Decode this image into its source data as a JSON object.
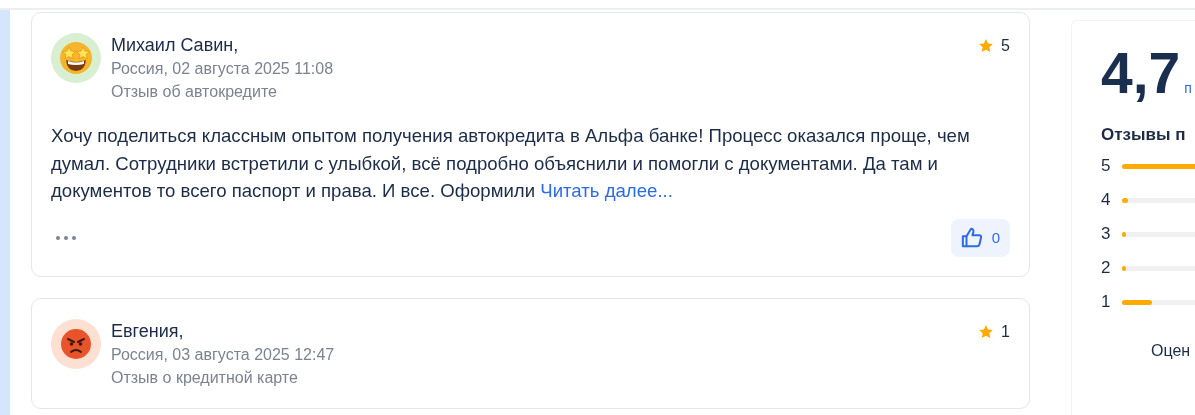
{
  "reviews": [
    {
      "author": "Михаил Савин,",
      "meta": "Россия, 02 августа 2025 11:08",
      "category": "Отзыв об автокредите",
      "kind": "star-struck",
      "rating": "5",
      "text": "Хочу поделиться классным опытом получения автокредита в Альфа банке! Процесс оказался проще, чем думал. Сотрудники встретили с улыбкой, всё подробно объяснили и помогли с документами. Да там и документов то всего паспорт и права. И все. Оформили",
      "read_more": "Читать далее...",
      "likes": "0"
    },
    {
      "author": "Евгения,",
      "meta": "Россия, 03 августа 2025 12:47",
      "category": "Отзыв о кредитной карте",
      "kind": "angry",
      "rating": "1"
    }
  ],
  "summary": {
    "score": "4,7",
    "score_link": "п",
    "title": "Отзывы п",
    "distribution": [
      {
        "label": "5",
        "level": 0.8
      },
      {
        "label": "4",
        "level": 0.04
      },
      {
        "label": "3",
        "level": 0.01
      },
      {
        "label": "2",
        "level": 0.02
      },
      {
        "label": "1",
        "level": 0.2
      }
    ],
    "footer": "Оцен"
  }
}
